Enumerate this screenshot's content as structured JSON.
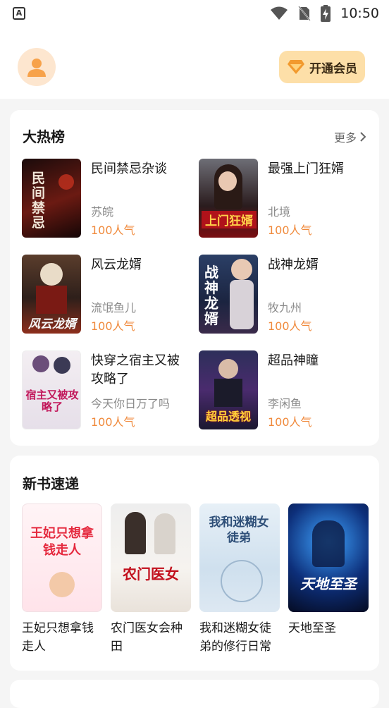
{
  "status_bar": {
    "time": "10:50",
    "notification_icon": "A"
  },
  "header": {
    "vip_button_label": "开通会员"
  },
  "hot_list": {
    "title": "大热榜",
    "more_label": "更多",
    "books": [
      {
        "title": "民间禁忌杂谈",
        "author": "苏皖",
        "popularity": "100人气",
        "cover_text": "民间禁忌"
      },
      {
        "title": "最强上门狂婿",
        "author": "北境",
        "popularity": "100人气",
        "cover_text": "上门狂婿"
      },
      {
        "title": "风云龙婿",
        "author": "流氓鱼儿",
        "popularity": "100人气",
        "cover_text": "风云龙婿"
      },
      {
        "title": "战神龙婿",
        "author": "牧九州",
        "popularity": "100人气",
        "cover_text": "战神龙婿"
      },
      {
        "title": "快穿之宿主又被攻略了",
        "author": "今天你日万了吗",
        "popularity": "100人气",
        "cover_text": "宿主又被攻略了"
      },
      {
        "title": "超品神瞳",
        "author": "李闲鱼",
        "popularity": "100人气",
        "cover_text": "超品透视"
      }
    ]
  },
  "new_books": {
    "title": "新书速递",
    "books": [
      {
        "title": "王妃只想拿钱走人",
        "cover_text": "王妃只想拿钱走人"
      },
      {
        "title": "农门医女会种田",
        "cover_text": "农门医女"
      },
      {
        "title": "我和迷糊女徒弟的修行日常",
        "cover_text": "我和迷糊女徒弟"
      },
      {
        "title": "天地至圣",
        "cover_text": "天地至圣"
      }
    ]
  }
}
